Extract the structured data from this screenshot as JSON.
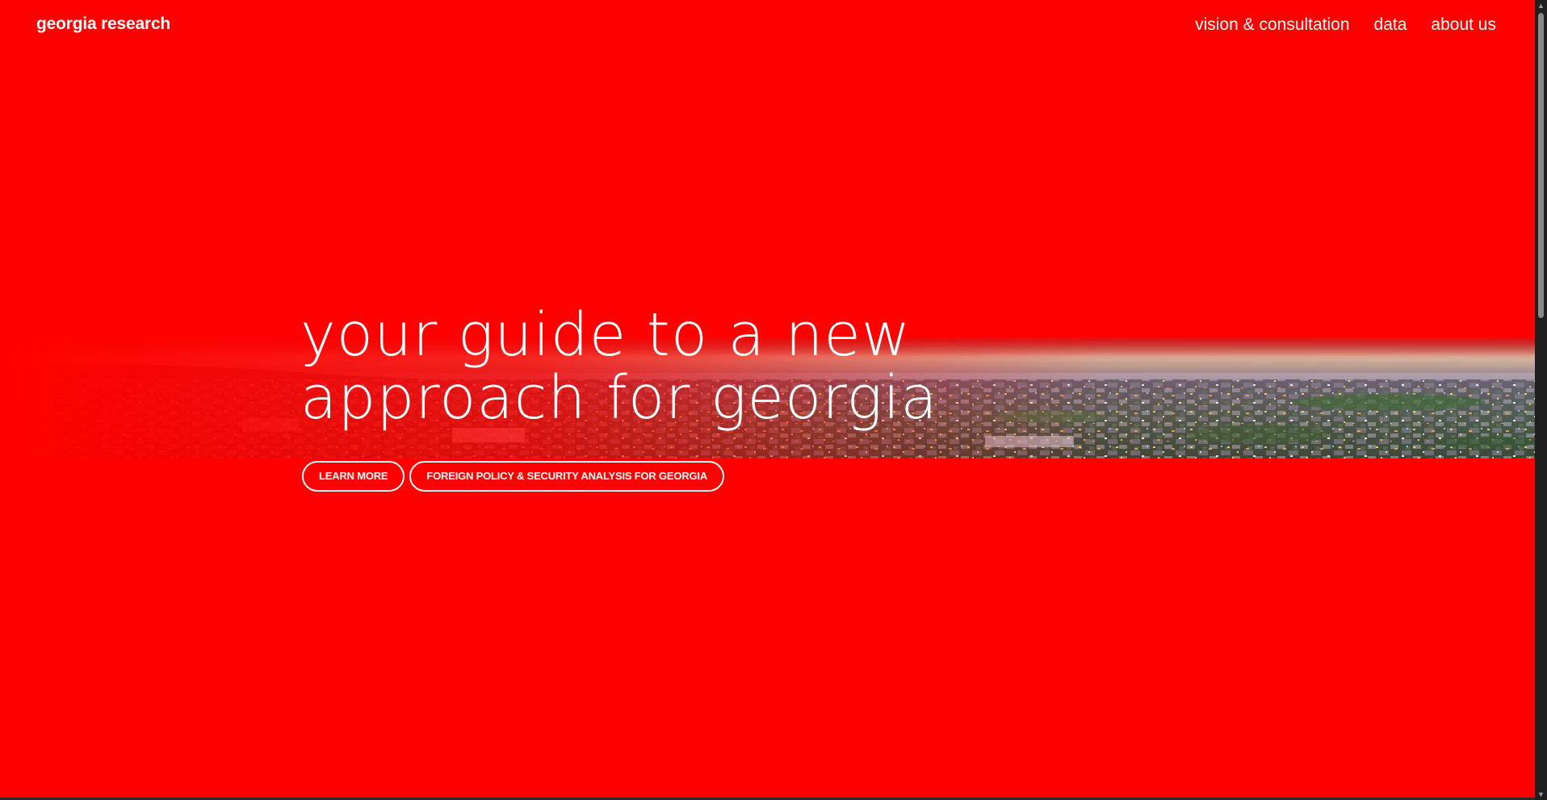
{
  "header": {
    "brand": "georgia research",
    "nav": [
      {
        "label": "vision & consultation"
      },
      {
        "label": "data"
      },
      {
        "label": "about us"
      }
    ]
  },
  "hero": {
    "headline_line1": "your guide to a new",
    "headline_line2": "approach for georgia",
    "buttons": [
      {
        "label": "LEARN MORE"
      },
      {
        "label": "FOREIGN POLICY & SECURITY ANALYSIS FOR GEORGIA"
      }
    ]
  },
  "colors": {
    "background": "#ff0000",
    "text": "#ffffff"
  },
  "scroll": {
    "up_icon": "triangle-up-icon",
    "down_icon": "triangle-down-icon",
    "position": 0
  }
}
